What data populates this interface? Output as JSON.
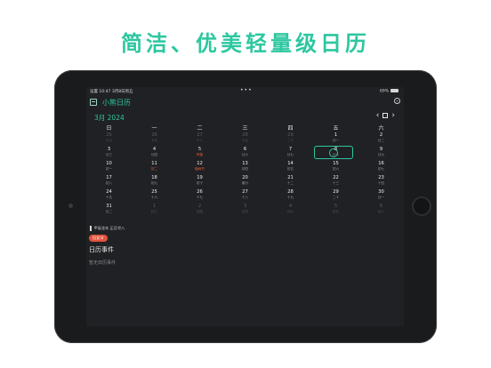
{
  "headline": "简洁、优美轻量级日历",
  "status": {
    "left": "设置  10:47  3月8日周五",
    "right": "69%"
  },
  "app": {
    "title": "小熊日历"
  },
  "calendar": {
    "month_label": "3月 2024",
    "weekdays": [
      "日",
      "一",
      "二",
      "三",
      "四",
      "五",
      "六"
    ],
    "days": [
      {
        "d": "25",
        "s": "十六",
        "other": true
      },
      {
        "d": "26",
        "s": "十七",
        "other": true
      },
      {
        "d": "27",
        "s": "十八",
        "other": true
      },
      {
        "d": "28",
        "s": "十九",
        "other": true
      },
      {
        "d": "29",
        "s": "二十",
        "other": true
      },
      {
        "d": "1",
        "s": "廿一"
      },
      {
        "d": "2",
        "s": "廿二"
      },
      {
        "d": "3",
        "s": "廿三"
      },
      {
        "d": "4",
        "s": "廿四"
      },
      {
        "d": "5",
        "s": "惊蛰",
        "red": true
      },
      {
        "d": "6",
        "s": "廿六"
      },
      {
        "d": "7",
        "s": "廿七"
      },
      {
        "d": "8",
        "s": "廿八"
      },
      {
        "d": "9",
        "s": "廿九"
      },
      {
        "d": "10",
        "s": "初一"
      },
      {
        "d": "11",
        "s": "初二",
        "red": true
      },
      {
        "d": "12",
        "s": "植树节",
        "red": true
      },
      {
        "d": "13",
        "s": "初四"
      },
      {
        "d": "14",
        "s": "初五"
      },
      {
        "d": "15",
        "s": "初六"
      },
      {
        "d": "16",
        "s": "初七"
      },
      {
        "d": "17",
        "s": "初八"
      },
      {
        "d": "18",
        "s": "初九"
      },
      {
        "d": "19",
        "s": "初十"
      },
      {
        "d": "20",
        "s": "春分"
      },
      {
        "d": "21",
        "s": "十二"
      },
      {
        "d": "22",
        "s": "十三"
      },
      {
        "d": "23",
        "s": "十四"
      },
      {
        "d": "24",
        "s": "十五"
      },
      {
        "d": "25",
        "s": "十六"
      },
      {
        "d": "26",
        "s": "十七"
      },
      {
        "d": "27",
        "s": "十八"
      },
      {
        "d": "28",
        "s": "十九"
      },
      {
        "d": "29",
        "s": "二十"
      },
      {
        "d": "30",
        "s": "廿一"
      },
      {
        "d": "31",
        "s": "廿二"
      },
      {
        "d": "1",
        "s": "廿三",
        "other": true
      },
      {
        "d": "2",
        "s": "廿四",
        "other": true
      },
      {
        "d": "3",
        "s": "廿五",
        "other": true
      },
      {
        "d": "4",
        "s": "廿六",
        "other": true
      },
      {
        "d": "5",
        "s": "廿七",
        "other": true
      },
      {
        "d": "6",
        "s": "廿八",
        "other": true
      }
    ]
  },
  "detail": {
    "lunar": "甲辰龙年 正月廿八",
    "festival": "妇女节",
    "events_title": "日历事件",
    "events_empty": "暂无日历事件"
  }
}
